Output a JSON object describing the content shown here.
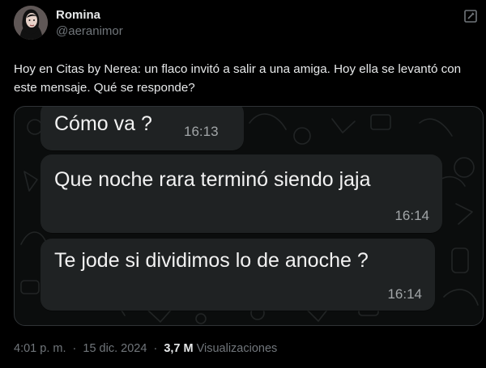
{
  "author": {
    "display_name": "Romina",
    "handle": "@aeranimor"
  },
  "post": {
    "text": "Hoy en Citas by Nerea: un flaco invitó a salir a una amiga. Hoy ella se levantó con este mensaje. Qué se responde?"
  },
  "media": {
    "messages": [
      {
        "text": "Cómo va ?",
        "time": "16:13"
      },
      {
        "text": "Que noche rara terminó siendo jaja",
        "time": "16:14"
      },
      {
        "text": "Te jode si dividimos lo de anoche ?",
        "time": "16:14"
      }
    ]
  },
  "footer": {
    "time": "4:01 p. m.",
    "date": "15 dic. 2024",
    "separator": "·",
    "views_count": "3,7 M",
    "views_label": "Visualizaciones"
  },
  "icons": {
    "edit": "edit-icon",
    "avatar": "profile-photo"
  },
  "colors": {
    "background": "#000000",
    "text_primary": "#e7e9ea",
    "text_secondary": "#71767b",
    "bubble": "#1f2223",
    "chat_background": "#0b0d0d"
  }
}
